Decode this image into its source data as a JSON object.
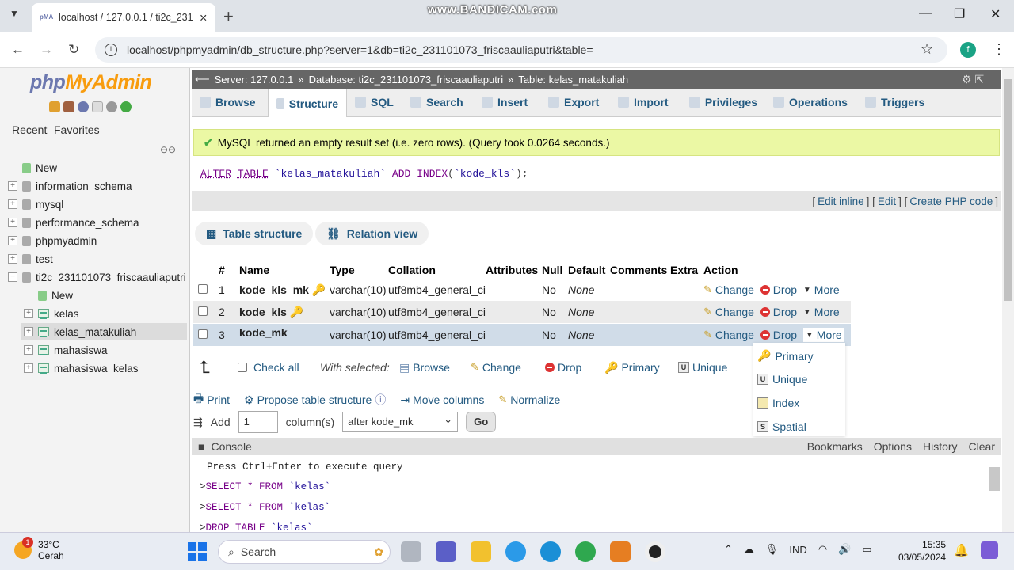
{
  "browser": {
    "tab_title": "localhost / 127.0.0.1 / ti2c_2311",
    "url": "localhost/phpmyadmin/db_structure.php?server=1&db=ti2c_231101073_friscaauliaputri&table=",
    "watermark": "www.BANDICAM.com",
    "profile_initial": "f"
  },
  "sidebar": {
    "logo_php": "php",
    "logo_myadmin": "MyAdmin",
    "recent": "Recent",
    "favorites": "Favorites",
    "tree": [
      {
        "label": "New",
        "type": "new"
      },
      {
        "label": "information_schema",
        "type": "db"
      },
      {
        "label": "mysql",
        "type": "db"
      },
      {
        "label": "performance_schema",
        "type": "db"
      },
      {
        "label": "phpmyadmin",
        "type": "db"
      },
      {
        "label": "test",
        "type": "db"
      },
      {
        "label": "ti2c_231101073_friscaauliaputri",
        "type": "db-open"
      }
    ],
    "subtree": [
      {
        "label": "New"
      },
      {
        "label": "kelas"
      },
      {
        "label": "kelas_matakuliah"
      },
      {
        "label": "mahasiswa"
      },
      {
        "label": "mahasiswa_kelas"
      }
    ]
  },
  "breadcrumb": {
    "server": "Server: 127.0.0.1",
    "database": "Database: ti2c_231101073_friscaauliaputri",
    "table": "Table: kelas_matakuliah"
  },
  "tabs": [
    "Browse",
    "Structure",
    "SQL",
    "Search",
    "Insert",
    "Export",
    "Import",
    "Privileges",
    "Operations",
    "Triggers"
  ],
  "message": "MySQL returned an empty result set (i.e. zero rows). (Query took 0.0264 seconds.)",
  "sql": {
    "alter": "ALTER",
    "table_kw": "TABLE",
    "table_name": "`kelas_matakuliah`",
    "add": "ADD",
    "index": "INDEX",
    "open": "(",
    "column": "`kode_kls`",
    "close": ");"
  },
  "edit_links": {
    "edit_inline": "Edit inline",
    "edit": "Edit",
    "create_php": "Create PHP code"
  },
  "subtabs": {
    "table_structure": "Table structure",
    "relation_view": "Relation view"
  },
  "table": {
    "headers": {
      "num": "#",
      "name": "Name",
      "type": "Type",
      "collation": "Collation",
      "attributes": "Attributes",
      "null": "Null",
      "default": "Default",
      "comments": "Comments",
      "extra": "Extra",
      "action": "Action"
    },
    "rows": [
      {
        "num": "1",
        "name": "kode_kls_mk",
        "type": "varchar(10)",
        "collation": "utf8mb4_general_ci",
        "null": "No",
        "default": "None"
      },
      {
        "num": "2",
        "name": "kode_kls",
        "type": "varchar(10)",
        "collation": "utf8mb4_general_ci",
        "null": "No",
        "default": "None"
      },
      {
        "num": "3",
        "name": "kode_mk",
        "type": "varchar(10)",
        "collation": "utf8mb4_general_ci",
        "null": "No",
        "default": "None"
      }
    ],
    "actions": {
      "change": "Change",
      "drop": "Drop",
      "more": "More"
    }
  },
  "with_selected": {
    "check_all": "Check all",
    "label": "With selected:",
    "browse": "Browse",
    "change": "Change",
    "drop": "Drop",
    "primary": "Primary",
    "unique": "Unique",
    "fulltext_tail": "ext"
  },
  "dropdown": {
    "primary": "Primary",
    "unique": "Unique",
    "index": "Index",
    "spatial": "Spatial"
  },
  "bottom_actions": {
    "print": "Print",
    "propose": "Propose table structure",
    "move": "Move columns",
    "normalize": "Normalize"
  },
  "add_column": {
    "add": "Add",
    "count": "1",
    "columns": "column(s)",
    "position": "after kode_mk",
    "go": "Go"
  },
  "console": {
    "title": "Console",
    "links": [
      "Bookmarks",
      "Options",
      "History",
      "Clear"
    ],
    "hint": "Press Ctrl+Enter to execute query",
    "q1_kw": "SELECT * FROM",
    "q1_id": "`kelas`",
    "q2_kw": "SELECT * FROM",
    "q2_id": "`kelas`",
    "q3_kw": "DROP TABLE",
    "q3_id": "`kelas`"
  },
  "taskbar": {
    "temp": "33°C",
    "weather": "Cerah",
    "weather_badge": "1",
    "search": "Search",
    "lang": "IND",
    "time": "15:35",
    "date": "03/05/2024"
  }
}
